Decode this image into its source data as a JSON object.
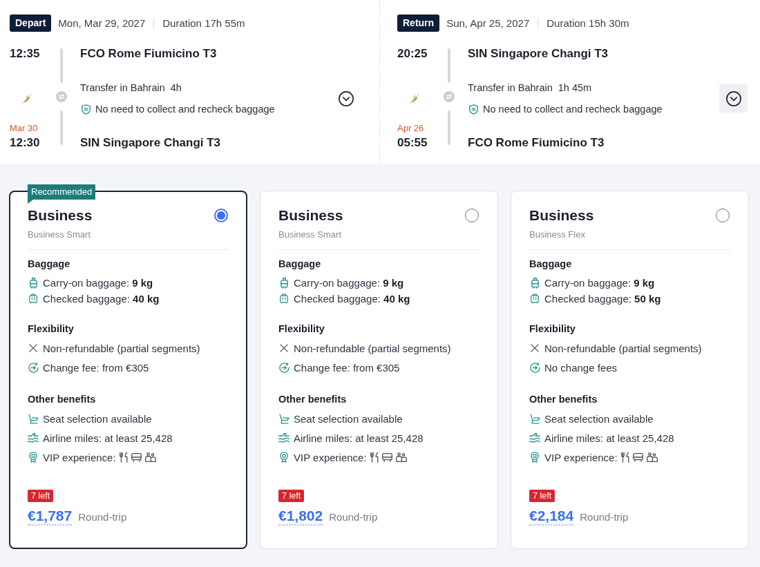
{
  "legs": [
    {
      "label": "Depart",
      "date": "Mon, Mar 29, 2027",
      "duration": "Duration 17h 55m",
      "departure": {
        "time": "12:35",
        "airport": "FCO Rome Fiumicino T3"
      },
      "transfer": {
        "place": "Transfer in Bahrain",
        "duration": "4h",
        "note": "No need to collect and recheck baggage"
      },
      "arrival": {
        "date_change": "Mar 30",
        "time": "12:30",
        "airport": "SIN Singapore Changi T3"
      },
      "expand_button": {
        "hovered": false
      }
    },
    {
      "label": "Return",
      "date": "Sun, Apr 25, 2027",
      "duration": "Duration 15h 30m",
      "departure": {
        "time": "20:25",
        "airport": "SIN Singapore Changi T3"
      },
      "transfer": {
        "place": "Transfer in Bahrain",
        "duration": "1h 45m",
        "note": "No need to collect and recheck baggage"
      },
      "arrival": {
        "date_change": "Apr 26",
        "time": "05:55",
        "airport": "FCO Rome Fiumicino T3"
      },
      "expand_button": {
        "hovered": true
      }
    }
  ],
  "fares": [
    {
      "tag": "Recommended",
      "cabin": "Business",
      "fare_name": "Business Smart",
      "selected": true,
      "sections": [
        {
          "kind": "baggage",
          "title": "Baggage",
          "items": [
            {
              "kind": "carry-on",
              "text": "Carry-on baggage: **9 kg**"
            },
            {
              "kind": "checked",
              "text": "Checked baggage: **40 kg**"
            }
          ]
        },
        {
          "kind": "flexibility",
          "title": "Flexibility",
          "items": [
            {
              "kind": "not-included",
              "text": "Non-refundable (partial segments)"
            },
            {
              "kind": "change",
              "text": "Change fee: from €305"
            }
          ]
        },
        {
          "kind": "benefits",
          "title": "Other benefits",
          "items": [
            {
              "kind": "seat",
              "text": "Seat selection available"
            },
            {
              "kind": "miles",
              "text": "Airline miles: at least 25,428"
            },
            {
              "kind": "vip",
              "text": "VIP experience:"
            }
          ]
        }
      ],
      "availability": "7 left",
      "price": "€1,787",
      "trip_type": "Round-trip"
    },
    {
      "cabin": "Business",
      "fare_name": "Business Smart",
      "selected": false,
      "sections": [
        {
          "kind": "baggage",
          "title": "Baggage",
          "items": [
            {
              "kind": "carry-on",
              "text": "Carry-on baggage: **9 kg**"
            },
            {
              "kind": "checked",
              "text": "Checked baggage: **40 kg**"
            }
          ]
        },
        {
          "kind": "flexibility",
          "title": "Flexibility",
          "items": [
            {
              "kind": "not-included",
              "text": "Non-refundable (partial segments)"
            },
            {
              "kind": "change",
              "text": "Change fee: from €305"
            }
          ]
        },
        {
          "kind": "benefits",
          "title": "Other benefits",
          "items": [
            {
              "kind": "seat",
              "text": "Seat selection available"
            },
            {
              "kind": "miles",
              "text": "Airline miles: at least 25,428"
            },
            {
              "kind": "vip",
              "text": "VIP experience:"
            }
          ]
        }
      ],
      "availability": "7 left",
      "price": "€1,802",
      "trip_type": "Round-trip"
    },
    {
      "cabin": "Business",
      "fare_name": "Business Flex",
      "selected": false,
      "sections": [
        {
          "kind": "baggage",
          "title": "Baggage",
          "items": [
            {
              "kind": "carry-on",
              "text": "Carry-on baggage: **9 kg**"
            },
            {
              "kind": "checked",
              "text": "Checked baggage: **50 kg**"
            }
          ]
        },
        {
          "kind": "flexibility",
          "title": "Flexibility",
          "items": [
            {
              "kind": "not-included",
              "text": "Non-refundable (partial segments)"
            },
            {
              "kind": "change",
              "text": "No change fees"
            }
          ]
        },
        {
          "kind": "benefits",
          "title": "Other benefits",
          "items": [
            {
              "kind": "seat",
              "text": "Seat selection available"
            },
            {
              "kind": "miles",
              "text": "Airline miles: at least 25,428"
            },
            {
              "kind": "vip",
              "text": "VIP experience:"
            }
          ]
        }
      ],
      "availability": "7 left",
      "price": "€2,184",
      "trip_type": "Round-trip"
    }
  ]
}
